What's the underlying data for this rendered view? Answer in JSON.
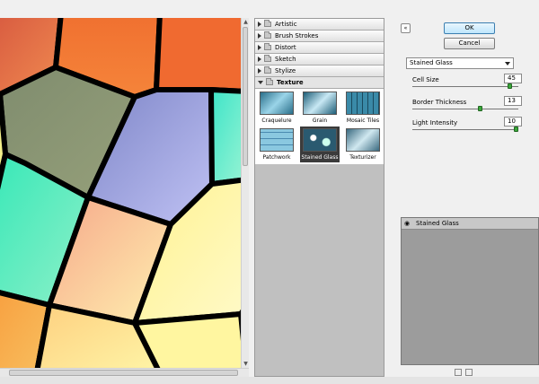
{
  "gallery": {
    "categories": [
      {
        "label": "Artistic",
        "open": false
      },
      {
        "label": "Brush Strokes",
        "open": false
      },
      {
        "label": "Distort",
        "open": false
      },
      {
        "label": "Sketch",
        "open": false
      },
      {
        "label": "Stylize",
        "open": false
      },
      {
        "label": "Texture",
        "open": true
      }
    ],
    "thumbnails": [
      {
        "label": "Craquelure",
        "selected": false
      },
      {
        "label": "Grain",
        "selected": false
      },
      {
        "label": "Mosaic Tiles",
        "selected": false
      },
      {
        "label": "Patchwork",
        "selected": false
      },
      {
        "label": "Stained Glass",
        "selected": true
      },
      {
        "label": "Texturizer",
        "selected": false
      }
    ]
  },
  "buttons": {
    "ok": "OK",
    "cancel": "Cancel",
    "collapse": "«"
  },
  "filter": {
    "selected": "Stained Glass",
    "params": [
      {
        "label": "Cell Size",
        "value": "45",
        "level": 0.94
      },
      {
        "label": "Border Thickness",
        "value": "13",
        "level": 0.65
      },
      {
        "label": "Light Intensity",
        "value": "10",
        "level": 1.0
      }
    ]
  },
  "layers": {
    "items": [
      {
        "label": "Stained Glass"
      }
    ]
  },
  "colors": {
    "cell_orange": "#f07830",
    "cell_olive": "#8a9670",
    "cell_lavender": "#8c8ccf",
    "cell_aqua": "#4ee0c0",
    "cell_yellow": "#fdf6a0",
    "cell_peach": "#f8c890",
    "border": "#000000",
    "knob": "#3aa83a"
  }
}
